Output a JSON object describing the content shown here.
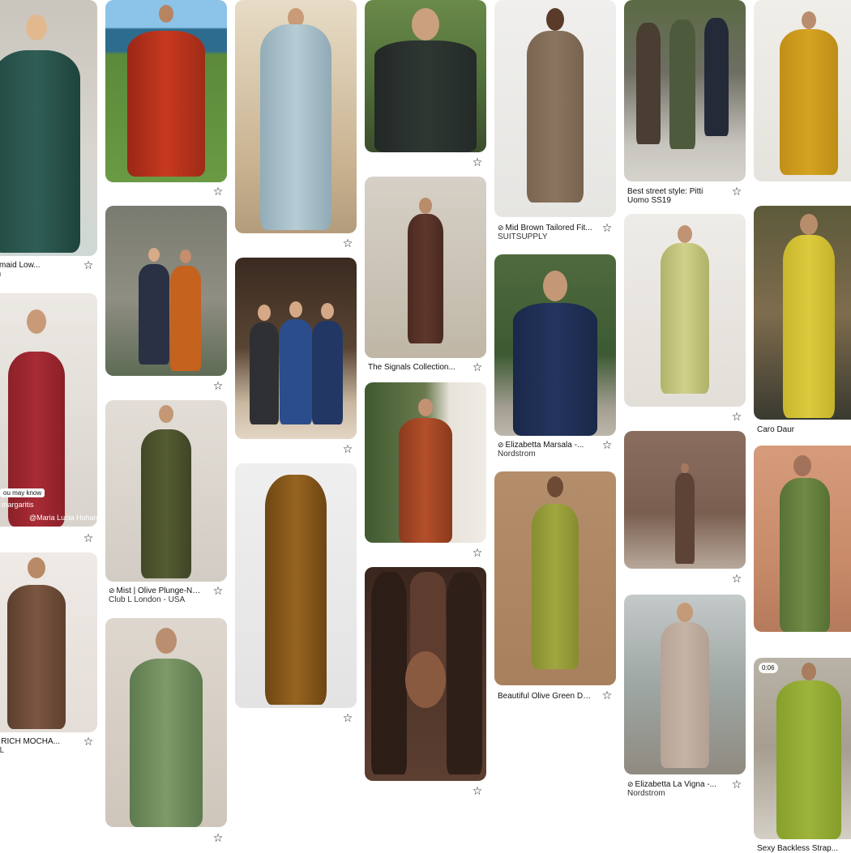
{
  "pins": {
    "c1p1": {
      "title": "c Mermaid Low...",
      "subtitle": "ntfash"
    },
    "c1p2": {
      "overlay_label": "ou may know",
      "overlay_name": "margaritis",
      "overlay_credit": "@Maria Lucia Hohan"
    },
    "c1p3": {
      "title": "OWN RICH MOCHA...",
      "subtitle": "LABEL"
    },
    "c2p3": {
      "tag_icon": "⊘",
      "title": "Mist | Olive Plunge-Nec...",
      "subtitle": "Club L London - USA"
    },
    "c4p2": {
      "title": "The Signals Collection..."
    },
    "c5p1": {
      "tag_icon": "⊘",
      "title": "Mid Brown Tailored Fit...",
      "subtitle": "SUITSUPPLY"
    },
    "c5p2": {
      "tag_icon": "⊘",
      "title": "Elizabetta Marsala -...",
      "subtitle": "Nordstrom"
    },
    "c5p3": {
      "title": "Beautiful Olive Green Dress"
    },
    "c6p1": {
      "title": "Best street style: Pitti",
      "subtitle": "Uomo SS19"
    },
    "c6p4": {
      "tag_icon": "⊘",
      "title": "Elizabetta La Vigna -...",
      "subtitle": "Nordstrom"
    },
    "c7p2": {
      "title": "Caro Daur"
    },
    "c7p4": {
      "badge": "0:06",
      "title": "Sexy Backless Strap..."
    }
  },
  "icons": {
    "save": "☆"
  },
  "colors": {
    "emerald": "#2f5e55",
    "red": "#b8321f",
    "pale_blue": "#a9c1cc",
    "suit_dark": "#2c3330",
    "tan_suit": "#8a7560",
    "street": "#6a6257",
    "mustard": "#d5a321",
    "crimson": "#a82b35",
    "orange": "#c4621e",
    "navy": "#1f2f55",
    "olive": "#4f5630",
    "chartreuse": "#c8c97c",
    "yellow": "#d9c73b",
    "mocha": "#6b4d39",
    "bronze": "#8a5a1d",
    "rust": "#a94927",
    "lime_olive": "#98a03b",
    "taupe": "#6d5042",
    "sage": "#7f9968",
    "choc": "#4a3328",
    "beige_suit": "#c5b3a6",
    "green_dress": "#6f8a45",
    "lime": "#9db43a"
  }
}
